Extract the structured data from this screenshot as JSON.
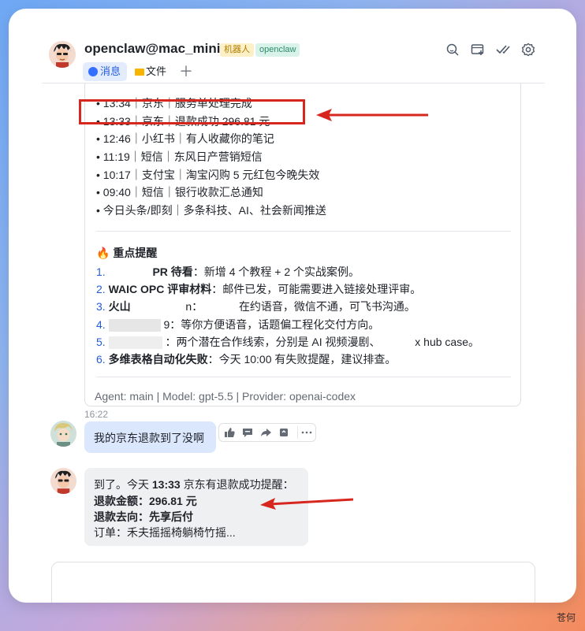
{
  "header": {
    "title": "openclaw@mac_mini",
    "badge_bot": "机器人",
    "badge_openclaw": "openclaw",
    "icons": [
      "search-icon",
      "add-tab-icon",
      "check-done-icon",
      "gear-icon"
    ]
  },
  "tabs": [
    {
      "label": "消息",
      "icon": "message-icon",
      "active": true
    },
    {
      "label": "文件",
      "icon": "folder-icon",
      "active": false
    },
    {
      "label": "＋",
      "icon": "plus-icon",
      "active": false
    }
  ],
  "card": {
    "list": [
      "• 13:34｜京东｜服务单处理完成",
      "• 13:33｜京东｜退款成功 296.81 元",
      "• 12:46｜小红书｜有人收藏你的笔记",
      "• 11:19｜短信｜东风日产营销短信",
      "• 10:17｜支付宝｜淘宝闪购 5 元红包今晚失效",
      "• 09:40｜短信｜银行收款汇总通知",
      "• 今日头条/即刻｜多条科技、AI、社会新闻推送"
    ],
    "section_icon": "🔥",
    "section_title": "重点提醒",
    "items": [
      {
        "num": "1.",
        "bold": "PR 待看",
        "text": "：新增 4 个教程 + 2 个实战案例。"
      },
      {
        "num": "2.",
        "bold": "WAIC OPC 评审材料",
        "text": "：邮件已发，可能需要进入链接处理评审。"
      },
      {
        "num": "3.",
        "bold": "火山",
        "mid": "n：",
        "text": "在约语音，微信不通，可飞书沟通。"
      },
      {
        "num": "4.",
        "bold": "",
        "mid": "9：",
        "text": "等你方便语音，话题偏工程化交付方向。"
      },
      {
        "num": "5.",
        "bold": "",
        "mid": "：",
        "text": "两个潜在合作线索，分别是 AI 视频漫剧、",
        "tail": "x hub case。"
      },
      {
        "num": "6.",
        "bold": "多维表格自动化失败",
        "text": "：今天 10:00 有失败提醒，建议排查。"
      }
    ],
    "meta": "Agent: main | Model: gpt-5.5 | Provider: openai-codex"
  },
  "chat": {
    "timestamp": "16:22",
    "user_message": "我的京东退款到了没啊",
    "actions": [
      "thumbs-up-icon",
      "comment-icon",
      "forward-icon",
      "pin-icon",
      "more-icon"
    ],
    "bot_lines": {
      "l1_pre": "到了。今天 ",
      "l1_bold": "13:33",
      "l1_post": " 京东有退款成功提醒：",
      "l2": "退款金额：296.81 元",
      "l3": "退款去向：先享后付",
      "l4": "订单：禾夫摇摇椅躺椅竹摇..."
    }
  },
  "annotation": {
    "color": "#d7261e"
  },
  "watermark": "苍何"
}
